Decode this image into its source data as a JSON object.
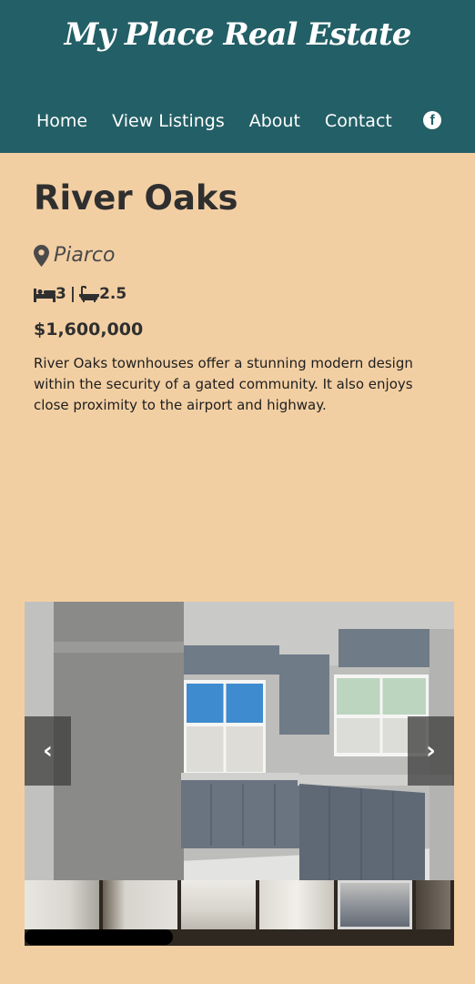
{
  "header": {
    "brand": "My Place Real Estate",
    "nav": [
      "Home",
      "View Listings",
      "About",
      "Contact"
    ],
    "social_icon": "facebook-icon",
    "colors": {
      "background": "#235f66",
      "text": "#ffffff"
    }
  },
  "listing": {
    "title": "River Oaks",
    "location": "Piarco",
    "bedrooms": "3",
    "separator": "|",
    "bathrooms": "2.5",
    "price": "$1,600,000",
    "description": "River Oaks townhouses offer a stunning modern design within the security of a gated community. It also enjoys close proximity to the airport and highway."
  },
  "gallery": {
    "prev_label": "‹",
    "next_label": "›",
    "thumbnail_count": 6,
    "active_thumbnail": 5
  },
  "colors": {
    "page_background": "#f2cfa3",
    "text": "#2f2f2f"
  }
}
